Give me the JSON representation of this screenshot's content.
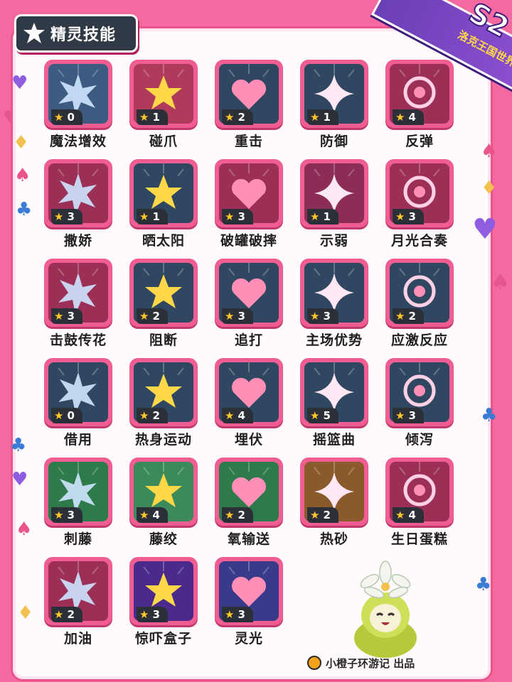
{
  "header": {
    "title": "精灵技能",
    "icon": "star-burst-icon"
  },
  "badge": {
    "season": "S2",
    "subtitle": "洛克王国世界"
  },
  "colors": {
    "background": "#f46aa0",
    "tile": "#ef5d92",
    "panel": "#fffafc",
    "header": "#303a46",
    "star": "#ffc928"
  },
  "skills": [
    {
      "name": "魔法增效",
      "cost": "0",
      "theme": "#3d5a80"
    },
    {
      "name": "碰爪",
      "cost": "1",
      "theme": "#b03a5b"
    },
    {
      "name": "重击",
      "cost": "2",
      "theme": "#2f4760"
    },
    {
      "name": "防御",
      "cost": "1",
      "theme": "#2f4760"
    },
    {
      "name": "反弹",
      "cost": "4",
      "theme": "#9c2f55"
    },
    {
      "name": "撒娇",
      "cost": "3",
      "theme": "#9c2f55"
    },
    {
      "name": "晒太阳",
      "cost": "1",
      "theme": "#2f4760"
    },
    {
      "name": "破罐破摔",
      "cost": "3",
      "theme": "#9c2f55"
    },
    {
      "name": "示弱",
      "cost": "1",
      "theme": "#8c2d55"
    },
    {
      "name": "月光合奏",
      "cost": "3",
      "theme": "#9c2f55"
    },
    {
      "name": "击鼓传花",
      "cost": "3",
      "theme": "#9c2f55"
    },
    {
      "name": "阻断",
      "cost": "2",
      "theme": "#2f4760"
    },
    {
      "name": "追打",
      "cost": "3",
      "theme": "#2f4760"
    },
    {
      "name": "主场优势",
      "cost": "3",
      "theme": "#2f4760"
    },
    {
      "name": "应激反应",
      "cost": "2",
      "theme": "#2f4760"
    },
    {
      "name": "借用",
      "cost": "0",
      "theme": "#2f4760"
    },
    {
      "name": "热身运动",
      "cost": "2",
      "theme": "#2f4760"
    },
    {
      "name": "埋伏",
      "cost": "4",
      "theme": "#2f4760"
    },
    {
      "name": "摇篮曲",
      "cost": "5",
      "theme": "#2f4760"
    },
    {
      "name": "倾泻",
      "cost": "3",
      "theme": "#2f4760"
    },
    {
      "name": "刺藤",
      "cost": "3",
      "theme": "#2f7a4a"
    },
    {
      "name": "藤绞",
      "cost": "4",
      "theme": "#3c8a5a"
    },
    {
      "name": "氧输送",
      "cost": "2",
      "theme": "#2f7a4a"
    },
    {
      "name": "热砂",
      "cost": "2",
      "theme": "#8a5a2a"
    },
    {
      "name": "生日蛋糕",
      "cost": "4",
      "theme": "#9c2f55"
    },
    {
      "name": "加油",
      "cost": "2",
      "theme": "#9c2f55"
    },
    {
      "name": "惊吓盒子",
      "cost": "3",
      "theme": "#4a2a8a"
    },
    {
      "name": "灵光",
      "cost": "3",
      "theme": "#3a3a8a"
    }
  ],
  "credit": {
    "text": "小橙子环游记 出品"
  }
}
